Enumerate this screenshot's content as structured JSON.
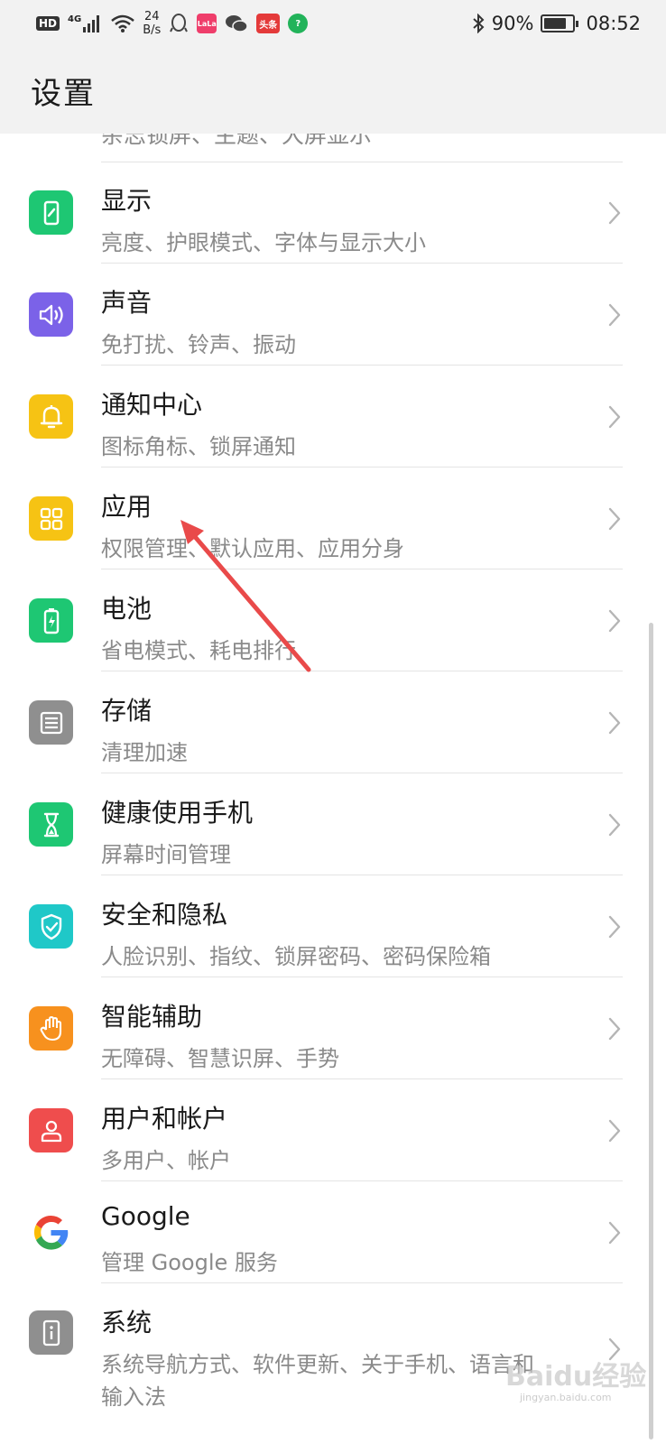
{
  "status_bar": {
    "network": "4G",
    "hd": "HD",
    "net_speed_value": "24",
    "net_speed_unit": "B/s",
    "notif_badges": [
      {
        "name": "qq-icon",
        "text": "",
        "color": "#555555"
      },
      {
        "name": "app-lala-icon",
        "text": "LaLa",
        "color": "#ef3e6b"
      },
      {
        "name": "wechat-icon",
        "text": "",
        "color": "#555555"
      },
      {
        "name": "toutiao-icon",
        "text": "头条",
        "color": "#e43a3a"
      },
      {
        "name": "security-icon",
        "text": "?",
        "color": "#22b35a"
      }
    ],
    "battery_percent": "90%",
    "battery_level": 0.9,
    "time": "08:52"
  },
  "header": {
    "title": "设置"
  },
  "partial_item": {
    "subtitle": "杂志锁屏、主题、大屏显示"
  },
  "items": [
    {
      "title": "显示",
      "subtitle": "亮度、护眼模式、字体与显示大小",
      "icon": "display-icon",
      "color": "#1ec773"
    },
    {
      "title": "声音",
      "subtitle": "免打扰、铃声、振动",
      "icon": "sound-icon",
      "color": "#7b62e8"
    },
    {
      "title": "通知中心",
      "subtitle": "图标角标、锁屏通知",
      "icon": "bell-icon",
      "color": "#f6c314"
    },
    {
      "title": "应用",
      "subtitle": "权限管理、默认应用、应用分身",
      "icon": "apps-grid-icon",
      "color": "#f6c314"
    },
    {
      "title": "电池",
      "subtitle": "省电模式、耗电排行",
      "icon": "battery-icon",
      "color": "#1ec773"
    },
    {
      "title": "存储",
      "subtitle": "清理加速",
      "icon": "storage-icon",
      "color": "#8f8f8f"
    },
    {
      "title": "健康使用手机",
      "subtitle": "屏幕时间管理",
      "icon": "hourglass-icon",
      "color": "#1ec773"
    },
    {
      "title": "安全和隐私",
      "subtitle": "人脸识别、指纹、锁屏密码、密码保险箱",
      "icon": "shield-icon",
      "color": "#1fc8c8"
    },
    {
      "title": "智能辅助",
      "subtitle": "无障碍、智慧识屏、手势",
      "icon": "hand-icon",
      "color": "#f7911e"
    },
    {
      "title": "用户和帐户",
      "subtitle": "多用户、帐户",
      "icon": "user-icon",
      "color": "#ef4d4d"
    },
    {
      "title": "Google",
      "subtitle": "管理 Google 服务",
      "icon": "google-icon",
      "color": "#ffffff"
    },
    {
      "title": "系统",
      "subtitle": "系统导航方式、软件更新、关于手机、语言和",
      "subtitle2": "输入法",
      "icon": "info-icon",
      "color": "#8f8f8f"
    }
  ],
  "watermark": {
    "text": "Baidu经验",
    "sub": "jingyan.baidu.com"
  }
}
